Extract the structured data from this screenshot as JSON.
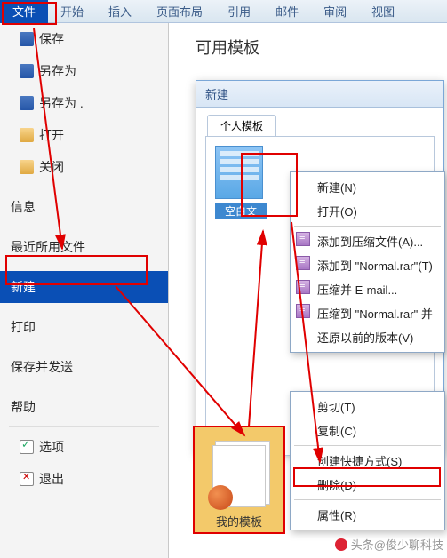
{
  "ribbon": {
    "tabs": [
      "文件",
      "开始",
      "插入",
      "页面布局",
      "引用",
      "邮件",
      "审阅",
      "视图"
    ],
    "active": 0
  },
  "left": {
    "items": [
      {
        "label": "保存",
        "icon": "disk"
      },
      {
        "label": "另存为",
        "icon": "disk"
      },
      {
        "label": "另存为 .",
        "icon": "disk"
      },
      {
        "label": "打开",
        "icon": "folder"
      },
      {
        "label": "关闭",
        "icon": "folder"
      }
    ],
    "info": "信息",
    "recent": "最近所用文件",
    "new": "新建",
    "print": "打印",
    "share": "保存并发送",
    "help": "帮助",
    "options": "选项",
    "exit": "退出"
  },
  "content_title": "可用模板",
  "dialog": {
    "title": "新建",
    "tab": "个人模板",
    "thumb_label": "空白文"
  },
  "ctx1": {
    "new": "新建(N)",
    "open": "打开(O)",
    "addToArchive": "添加到压缩文件(A)...",
    "addToNormal": "添加到 \"Normal.rar\"(T)",
    "compressEmail": "压缩并 E-mail...",
    "compressNormal": "压缩到 \"Normal.rar\" 并",
    "restore": "还原以前的版本(V)"
  },
  "ctx2": {
    "cut": "剪切(T)",
    "copy": "复制(C)",
    "shortcut": "创建快捷方式(S)",
    "delete": "删除(D)",
    "properties": "属性(R)"
  },
  "mytpl": "我的模板",
  "watermark": "头条@俊少聊科技"
}
